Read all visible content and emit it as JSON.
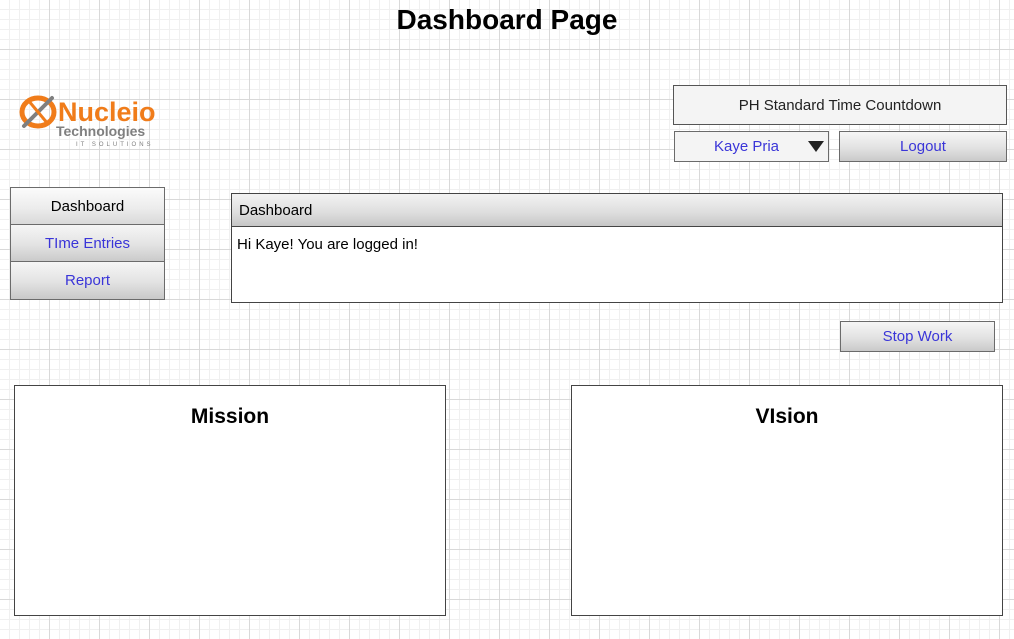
{
  "page": {
    "title": "Dashboard Page"
  },
  "logo": {
    "brand": "Nucleio",
    "subtitle": "Technologies",
    "tagline": "IT SOLUTIONS",
    "colors": {
      "orange": "#f07c1a",
      "gray": "#7f7f7f"
    }
  },
  "header": {
    "countdown_label": "PH Standard Time Countdown",
    "user_name": "Kaye Pria",
    "logout_label": "Logout"
  },
  "sidebar": {
    "items": [
      {
        "label": "Dashboard",
        "active": true
      },
      {
        "label": "TIme Entries",
        "active": false
      },
      {
        "label": "Report",
        "active": false
      }
    ]
  },
  "dashboard_panel": {
    "header": "Dashboard",
    "message": "Hi Kaye! You are logged in!"
  },
  "actions": {
    "stop_work_label": "Stop Work"
  },
  "mission": {
    "title": "Mission"
  },
  "vision": {
    "title": "VIsion"
  },
  "colors": {
    "link": "#3a35d8",
    "border": "#444444"
  }
}
